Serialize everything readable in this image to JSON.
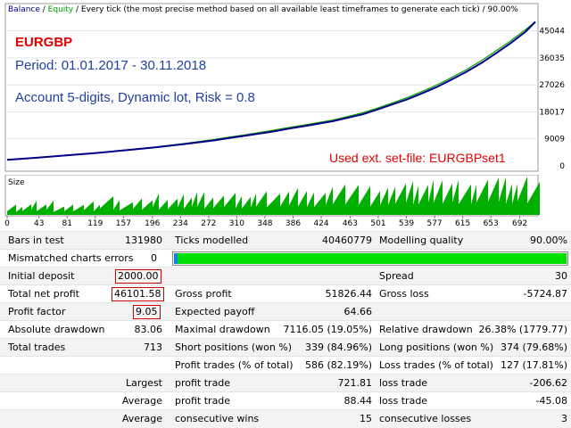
{
  "chart_header": {
    "balance": "Balance",
    "sep1": " / ",
    "equity": "Equity",
    "sep2": " / ",
    "info": "Every tick (the most precise method based on all available least timeframes to generate each tick)",
    "sep3": " / ",
    "quality": "90.00%"
  },
  "annotations": {
    "symbol": "EURGBP",
    "period": "Period: 01.01.2017 - 30.11.2018",
    "account": "Account 5-digits, Dynamic lot, Risk = 0.8",
    "setfile": "Used ext. set-file: EURGBPset1"
  },
  "colors": {
    "balance_line": "#00008b",
    "equity_line": "#00a000",
    "size_fill": "#00b000",
    "symbol_text": "#e00000",
    "annotation_text": "#2040a0",
    "setfile_text": "#e00000"
  },
  "size_label": "Size",
  "chart_data": {
    "type": "line",
    "y_tick_labels": [
      "45044",
      "36035",
      "27026",
      "18017",
      "9009",
      "0"
    ],
    "x_tick_labels": [
      "0",
      "43",
      "81",
      "119",
      "157",
      "196",
      "234",
      "272",
      "310",
      "348",
      "386",
      "424",
      "463",
      "501",
      "539",
      "577",
      "615",
      "653",
      "692"
    ],
    "x_range": [
      0,
      713
    ],
    "y_range": [
      0,
      50000
    ],
    "series": [
      {
        "name": "Balance",
        "x": [
          0,
          40,
          80,
          120,
          160,
          200,
          240,
          280,
          300,
          320,
          360,
          380,
          400,
          440,
          480,
          500,
          520,
          540,
          560,
          580,
          600,
          620,
          640,
          660,
          680,
          700,
          713
        ],
        "y": [
          2000,
          2700,
          3500,
          4300,
          5200,
          6200,
          7300,
          8500,
          9300,
          10000,
          11500,
          12400,
          13200,
          14900,
          17200,
          18800,
          20500,
          22200,
          24200,
          26300,
          28800,
          31400,
          34300,
          37600,
          41000,
          44800,
          48100
        ]
      },
      {
        "name": "Equity",
        "x": [
          0,
          40,
          80,
          120,
          160,
          200,
          240,
          280,
          300,
          320,
          360,
          380,
          400,
          440,
          480,
          500,
          520,
          540,
          560,
          580,
          600,
          620,
          640,
          660,
          680,
          700,
          713
        ],
        "y": [
          2000,
          2750,
          3550,
          4350,
          5300,
          6300,
          7500,
          8800,
          9600,
          10300,
          11900,
          12800,
          13600,
          15300,
          17700,
          19300,
          21000,
          22800,
          24800,
          27000,
          29500,
          32100,
          35100,
          38400,
          41800,
          45500,
          48100
        ]
      }
    ]
  },
  "report": {
    "bars_label": "Bars in test",
    "bars_value": "131980",
    "ticks_label": "Ticks modelled",
    "ticks_value": "40460779",
    "mq_label": "Modelling quality",
    "mq_value": "90.00%",
    "mq_fraction": 0.9,
    "mismatch_label": "Mismatched charts errors",
    "mismatch_value": "0",
    "initial_label": "Initial deposit",
    "initial_value": "2000.00",
    "spread_label": "Spread",
    "spread_value": "30",
    "netprofit_label": "Total net profit",
    "netprofit_value": "46101.58",
    "grossprofit_label": "Gross profit",
    "grossprofit_value": "51826.44",
    "grossloss_label": "Gross loss",
    "grossloss_value": "-5724.87",
    "pf_label": "Profit factor",
    "pf_value": "9.05",
    "ep_label": "Expected payoff",
    "ep_value": "64.66",
    "absdd_label": "Absolute drawdown",
    "absdd_value": "83.06",
    "maxdd_label": "Maximal drawdown",
    "maxdd_value": "7116.05 (19.05%)",
    "reldd_label": "Relative drawdown",
    "reldd_value": "26.38% (1779.77)",
    "trades_label": "Total trades",
    "trades_value": "713",
    "short_label": "Short positions (won %)",
    "short_value": "339 (84.96%)",
    "long_label": "Long positions (won %)",
    "long_value": "374 (79.68%)",
    "pt_label": "Profit trades (% of total)",
    "pt_value": "586 (82.19%)",
    "lt_label": "Loss trades (% of total)",
    "lt_value": "127 (17.81%)",
    "largest_label": "Largest",
    "largest_pt_label": "profit trade",
    "largest_pt_value": "721.81",
    "largest_lt_label": "loss trade",
    "largest_lt_value": "-206.62",
    "average_label": "Average",
    "average_pt_label": "profit trade",
    "average_pt_value": "88.44",
    "average_lt_label": "loss trade",
    "average_lt_value": "-45.08",
    "average2_label": "Average",
    "cw_label": "consecutive wins",
    "cw_value": "15",
    "cl_label": "consecutive losses",
    "cl_value": "3"
  }
}
